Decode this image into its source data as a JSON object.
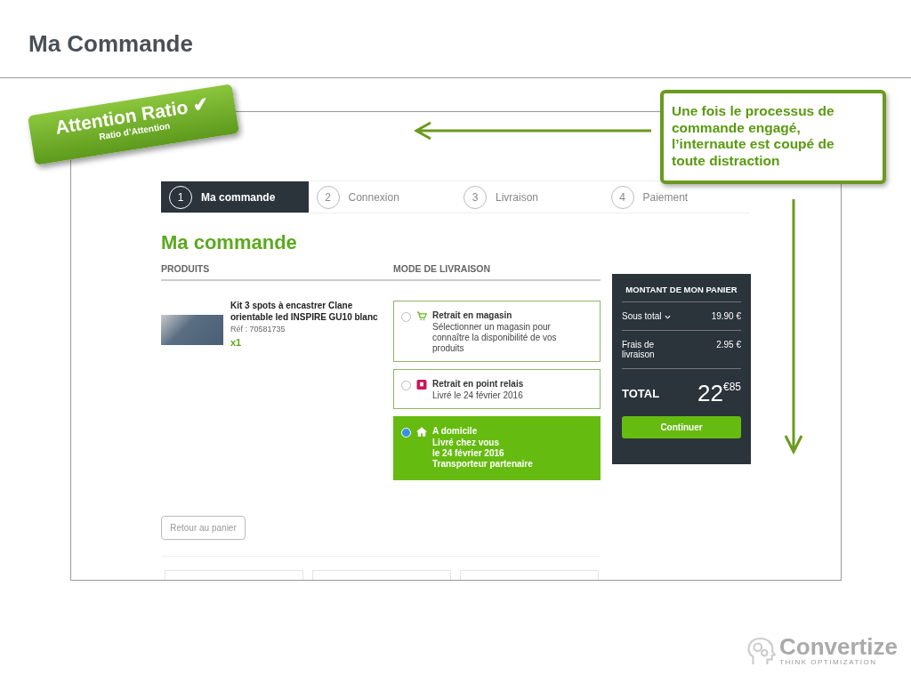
{
  "slide_title": "Ma Commande",
  "badge": {
    "title": "Attention Ratio ✔",
    "subtitle": "Ratio d’Attention"
  },
  "callout": "Une fois le processus de commande engagé, l’internaute est coupé de toute distraction",
  "steps": [
    {
      "number": "1",
      "label": "Ma commande",
      "selected": true
    },
    {
      "number": "2",
      "label": "Connexion",
      "selected": false
    },
    {
      "number": "3",
      "label": "Livraison",
      "selected": false
    },
    {
      "number": "4",
      "label": "Paiement",
      "selected": false
    }
  ],
  "page_title": "Ma commande",
  "columns": [
    "PRODUITS",
    "MODE DE LIVRAISON"
  ],
  "product": {
    "name": "Kit 3 spots à encastrer Clane orientable led INSPIRE GU10 blanc",
    "ref": "Réf : 70581735",
    "quantity": "x1"
  },
  "delivery_options": [
    {
      "kind": "store",
      "title": "Retrait en magasin",
      "lines": [
        "Sélectionner un magasin pour connaître la disponibilité de vos produits"
      ],
      "selected": false
    },
    {
      "kind": "relay",
      "title": "Retrait en point relais",
      "lines": [
        "Livré le 24 février 2016"
      ],
      "selected": false
    },
    {
      "kind": "home",
      "title": "A domicile",
      "lines": [
        "Livré chez vous",
        "le 24 février 2016",
        "Transporteur partenaire"
      ],
      "selected": true
    }
  ],
  "cart": {
    "title": "MONTANT DE MON PANIER",
    "rows": [
      {
        "label": "Sous total",
        "value": "19.90 €",
        "expandable": true
      },
      {
        "label": "Frais de livraison",
        "value": "2.95 €",
        "expandable": false
      }
    ],
    "total_label": "TOTAL",
    "total_units": "22",
    "total_cents": "€85",
    "button": "Continuer"
  },
  "back_button": "Retour au panier",
  "logo": {
    "name": "Convertize",
    "tagline": "THINK OPTIMIZATION"
  }
}
